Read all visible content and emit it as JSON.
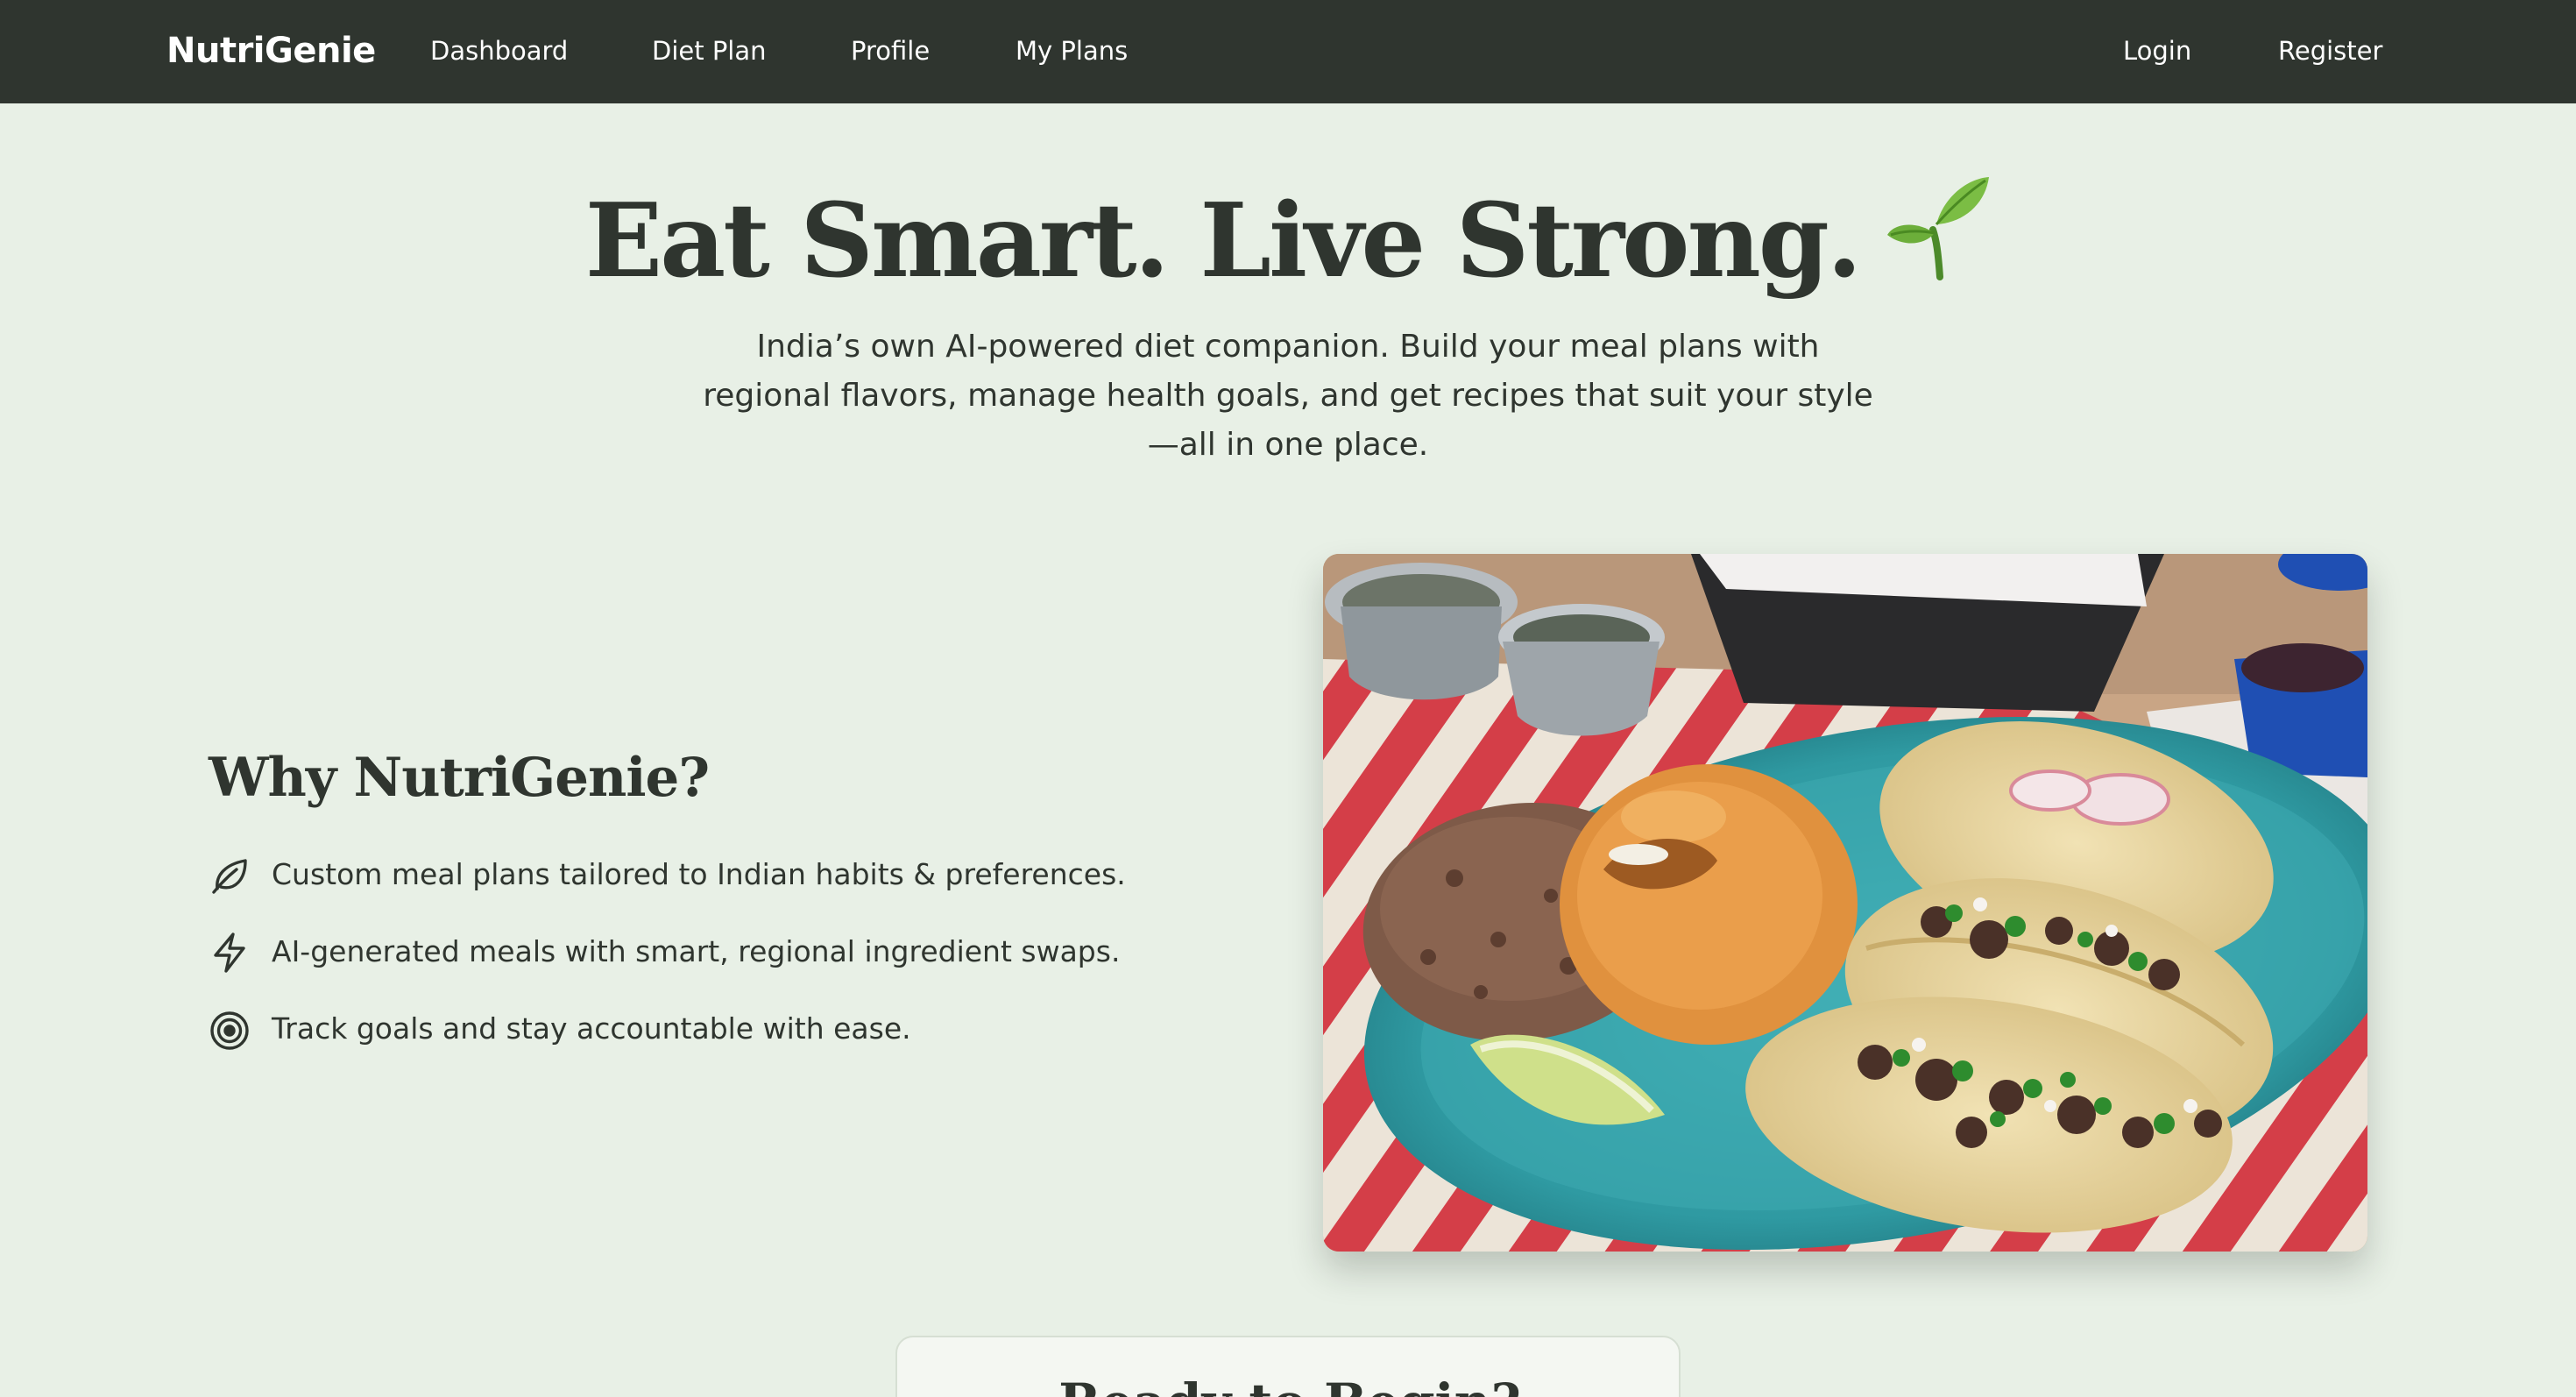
{
  "navbar": {
    "brand": "NutriGenie",
    "links": [
      "Dashboard",
      "Diet Plan",
      "Profile",
      "My Plans"
    ],
    "auth": {
      "login": "Login",
      "register": "Register"
    }
  },
  "hero": {
    "title": "Eat Smart. Live Strong.",
    "title_icon": "sprout-icon",
    "subtitle_lines": [
      "India’s own AI-powered diet companion. Build your meal plans with",
      "regional flavors, manage health goals, and get recipes that suit your style",
      "—all in one place."
    ]
  },
  "why": {
    "title": "Why NutriGenie?",
    "features": [
      {
        "icon": "leaf-icon",
        "text": "Custom meal plans tailored to Indian habits & preferences."
      },
      {
        "icon": "lightning-icon",
        "text": "AI-generated meals with smart, regional ingredient swaps."
      },
      {
        "icon": "target-icon",
        "text": "Track goals and stay accountable with ease."
      }
    ]
  },
  "food_image": {
    "alt": "tacos-rice-beans-plate-photo"
  },
  "bottom_card": {
    "title": "Ready to Begin?"
  },
  "colors": {
    "background": "#e8f0e6",
    "navbar": "#2f352f",
    "text": "#2f352f",
    "plate": "#3aa3a8"
  }
}
